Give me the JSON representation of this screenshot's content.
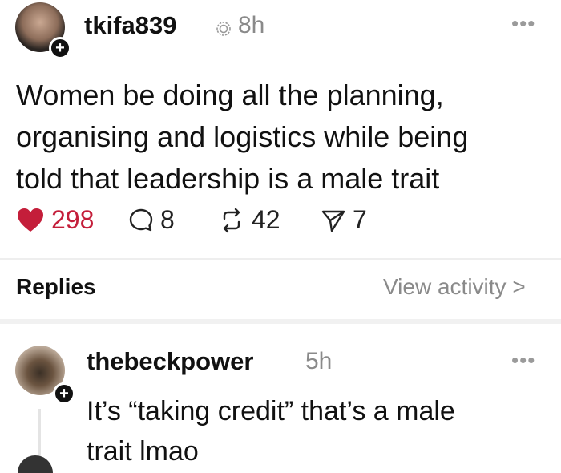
{
  "post": {
    "username": "tkifa839",
    "time": "8h",
    "more_label": "•••",
    "text_lines": [
      "Women be doing all the planning,",
      "organising and logistics while being",
      "told that leadership is a male trait"
    ],
    "likes": "298",
    "replies": "8",
    "reposts": "42",
    "shares": "7",
    "like_color": "#c41e3a"
  },
  "section": {
    "replies_label": "Replies",
    "view_activity": "View activity >"
  },
  "reply": {
    "username": "thebeckpower",
    "time": "5h",
    "more_label": "•••",
    "text_lines": [
      "It’s “taking credit” that’s a male",
      "trait lmao"
    ]
  },
  "icons": {
    "follow": "+",
    "verified": "verified-badge-icon",
    "like": "heart-icon",
    "reply": "comment-icon",
    "repost": "repost-icon",
    "share": "share-icon"
  }
}
